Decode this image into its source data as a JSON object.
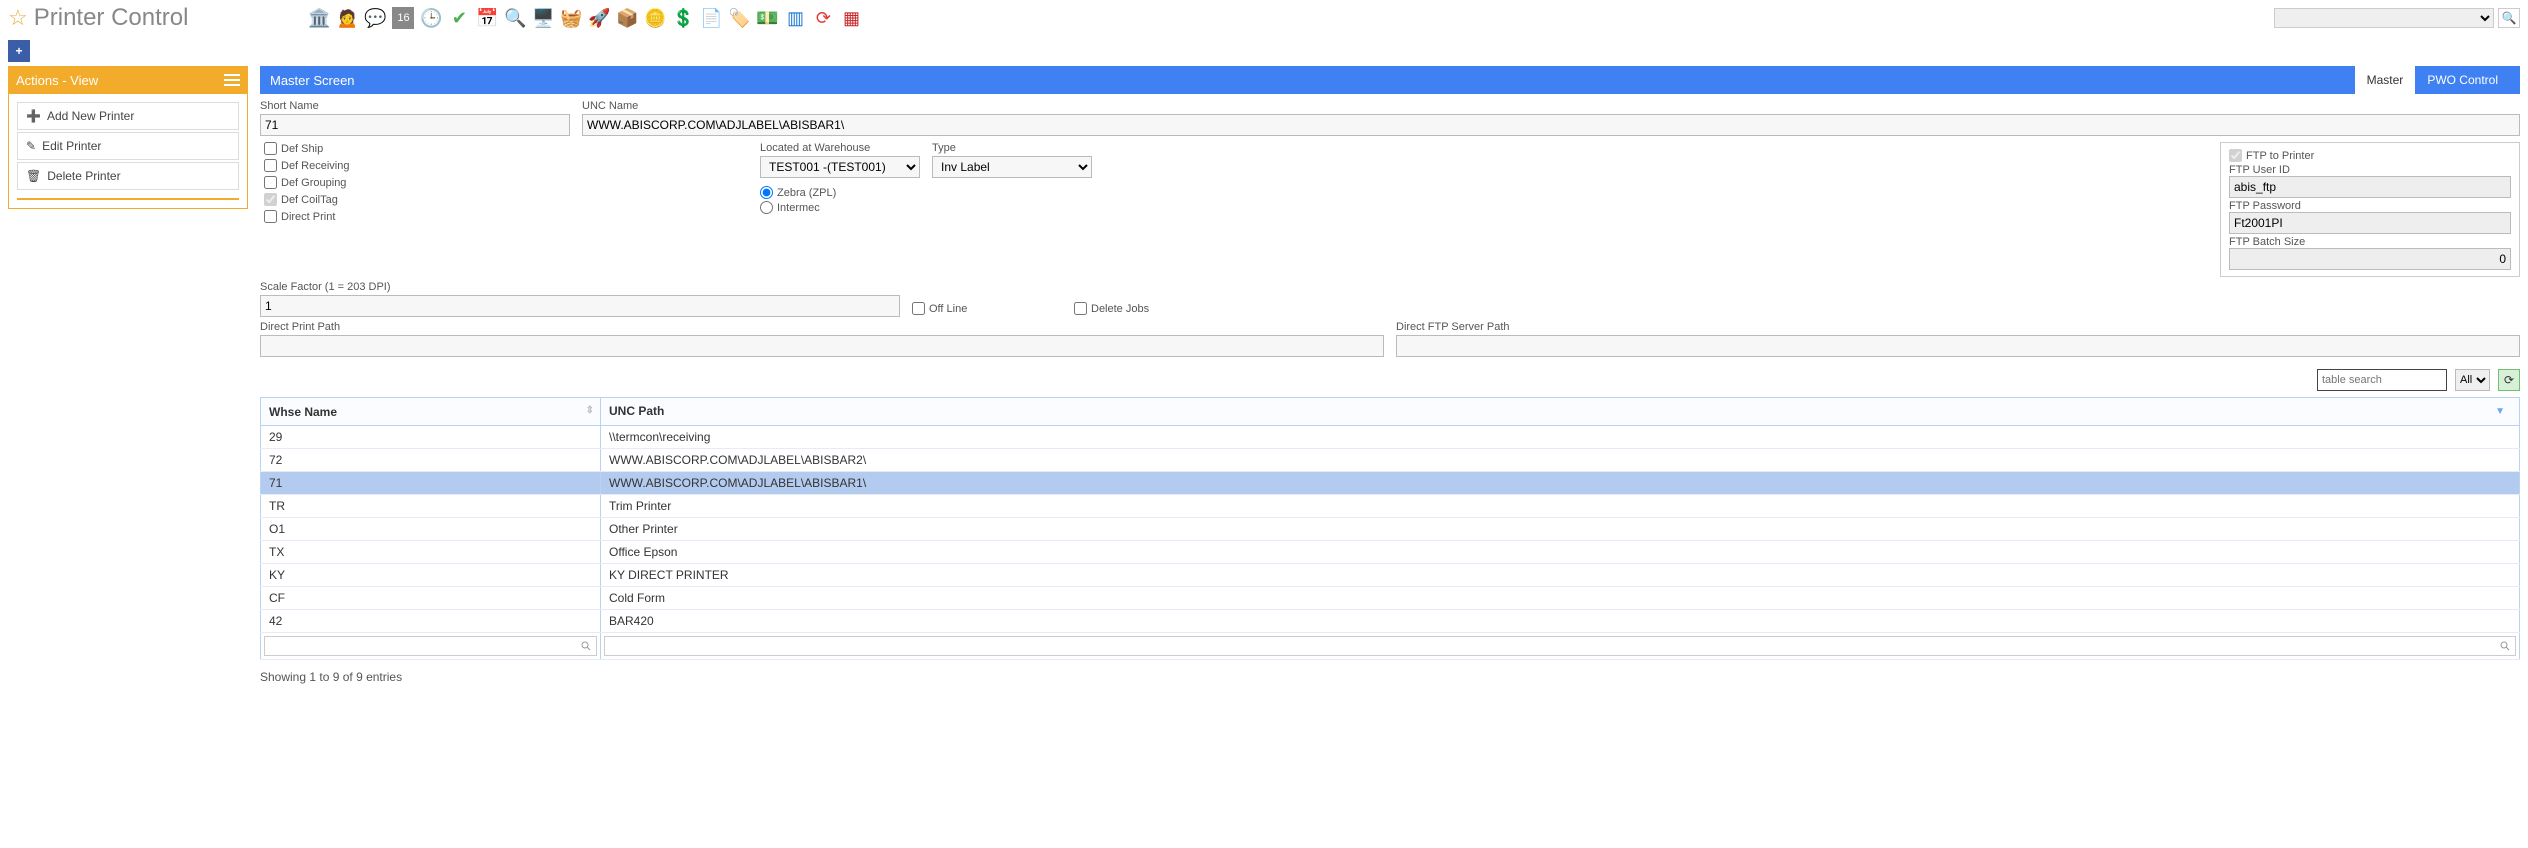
{
  "page": {
    "title": "Printer Control"
  },
  "actions": {
    "header": "Actions - View",
    "items": [
      {
        "icon": "➕",
        "label": "Add New Printer"
      },
      {
        "icon": "✎",
        "label": "Edit Printer"
      },
      {
        "icon": "🗑",
        "label": "Delete Printer"
      }
    ]
  },
  "masterBar": {
    "title": "Master Screen",
    "tabs": [
      {
        "label": "Master",
        "active": true
      },
      {
        "label": "PWO Control",
        "active": false
      }
    ]
  },
  "form": {
    "shortName": {
      "label": "Short Name",
      "value": "71"
    },
    "uncName": {
      "label": "UNC Name",
      "value": "WWW.ABISCORP.COM\\ADJLABEL\\ABISBAR1\\"
    },
    "checks": {
      "defShip": {
        "label": "Def Ship",
        "checked": false
      },
      "defReceiving": {
        "label": "Def Receiving",
        "checked": false
      },
      "defGrouping": {
        "label": "Def Grouping",
        "checked": false
      },
      "defCoilTag": {
        "label": "Def CoilTag",
        "checked": true
      },
      "directPrint": {
        "label": "Direct Print",
        "checked": false
      }
    },
    "warehouse": {
      "label": "Located at Warehouse",
      "value": "TEST001 -(TEST001)"
    },
    "type": {
      "label": "Type",
      "value": "Inv Label"
    },
    "radio": {
      "zebra": {
        "label": "Zebra (ZPL)",
        "checked": true
      },
      "intermec": {
        "label": "Intermec",
        "checked": false
      }
    },
    "offline": {
      "label": "Off Line",
      "checked": false
    },
    "deleteJobs": {
      "label": "Delete Jobs",
      "checked": false
    },
    "scale": {
      "label": "Scale Factor (1 = 203 DPI)",
      "value": "1"
    },
    "directPrintPath": {
      "label": "Direct Print Path",
      "value": ""
    },
    "directFtpServerPath": {
      "label": "Direct FTP Server Path",
      "value": ""
    },
    "ftp": {
      "toPrinter": {
        "label": "FTP to Printer",
        "checked": true
      },
      "user": {
        "label": "FTP User ID",
        "value": "abis_ftp"
      },
      "password": {
        "label": "FTP Password",
        "value": "Ft2001PI"
      },
      "batch": {
        "label": "FTP Batch Size",
        "value": "0"
      }
    }
  },
  "tableControls": {
    "searchPlaceholder": "table search",
    "allLabel": "All"
  },
  "table": {
    "headers": {
      "whse": "Whse Name",
      "unc": "UNC Path"
    },
    "rows": [
      {
        "whse": "29",
        "unc": "\\\\termcon\\receiving"
      },
      {
        "whse": "72",
        "unc": "WWW.ABISCORP.COM\\ADJLABEL\\ABISBAR2\\"
      },
      {
        "whse": "71",
        "unc": "WWW.ABISCORP.COM\\ADJLABEL\\ABISBAR1\\",
        "selected": true
      },
      {
        "whse": "TR",
        "unc": "Trim Printer"
      },
      {
        "whse": "O1",
        "unc": "Other Printer"
      },
      {
        "whse": "TX",
        "unc": "Office Epson"
      },
      {
        "whse": "KY",
        "unc": "KY DIRECT PRINTER"
      },
      {
        "whse": "CF",
        "unc": "Cold Form"
      },
      {
        "whse": "42",
        "unc": "BAR420"
      }
    ],
    "showing": "Showing 1 to 9 of 9 entries"
  }
}
